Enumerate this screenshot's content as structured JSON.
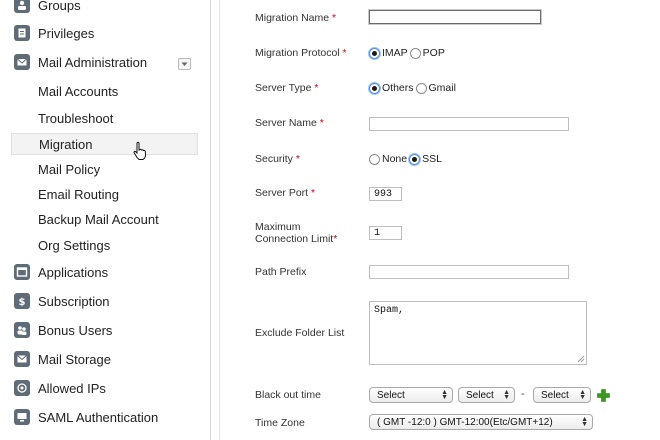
{
  "sidebar": {
    "items": [
      {
        "label": "Groups",
        "icon": "groups-icon"
      },
      {
        "label": "Privileges",
        "icon": "privileges-icon"
      },
      {
        "label": "Mail Administration",
        "icon": "mail-icon"
      },
      {
        "label": "Applications",
        "icon": "applications-icon"
      },
      {
        "label": "Subscription",
        "icon": "dollar-icon"
      },
      {
        "label": "Bonus Users",
        "icon": "users-icon"
      },
      {
        "label": "Mail Storage",
        "icon": "storage-icon"
      },
      {
        "label": "Allowed IPs",
        "icon": "ip-icon"
      },
      {
        "label": "SAML Authentication",
        "icon": "saml-icon"
      }
    ],
    "sub": [
      {
        "label": "Mail Accounts"
      },
      {
        "label": "Troubleshoot"
      },
      {
        "label": "Migration"
      },
      {
        "label": "Mail Policy"
      },
      {
        "label": "Email Routing"
      },
      {
        "label": "Backup Mail Account"
      },
      {
        "label": "Org Settings"
      }
    ]
  },
  "form": {
    "required_mark": "*",
    "migration_name": {
      "label": "Migration Name",
      "value": ""
    },
    "protocol": {
      "label": "Migration Protocol",
      "options": [
        "IMAP",
        "POP"
      ],
      "selected": "IMAP"
    },
    "server_type": {
      "label": "Server Type",
      "options": [
        "Others",
        "Gmail"
      ],
      "selected": "Others"
    },
    "server_name": {
      "label": "Server Name",
      "value": ""
    },
    "security": {
      "label": "Security",
      "options": [
        "None",
        "SSL"
      ],
      "selected": "SSL"
    },
    "server_port": {
      "label": "Server Port",
      "value": "993"
    },
    "max_conn": {
      "label_line1": "Maximum",
      "label_line2": "Connection Limit",
      "value": "1"
    },
    "path_prefix": {
      "label": "Path Prefix",
      "value": ""
    },
    "exclude": {
      "label": "Exclude Folder List",
      "value": "Spam,"
    },
    "blackout": {
      "label": "Black out time",
      "select1": "Select",
      "select2": "Select",
      "separator": "-",
      "select3": "Select"
    },
    "timezone": {
      "label": "Time Zone",
      "value": "( GMT -12:0 ) GMT-12:00(Etc/GMT+12)"
    }
  },
  "colors": {
    "required": "#d0021b",
    "add_green": "#3a9a1f",
    "icon_gray": "#5f6b76"
  }
}
